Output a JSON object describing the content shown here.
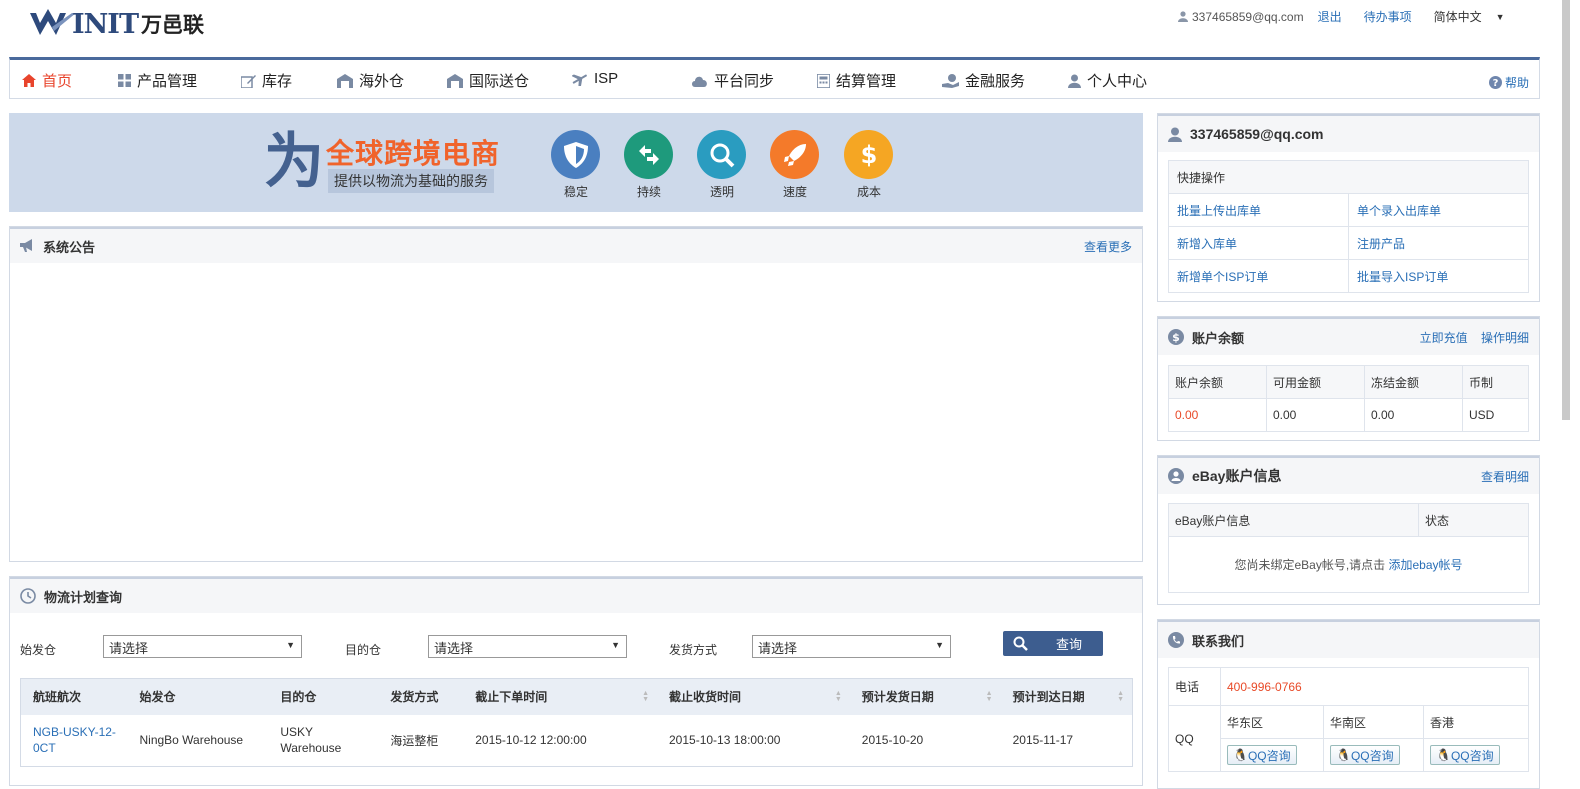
{
  "header": {
    "logo_text": "INIT",
    "logo_cn": "万邑联",
    "user_email": "337465859@qq.com",
    "logout": "退出",
    "todo": "待办事项",
    "language": "简体中文"
  },
  "nav": {
    "items": [
      {
        "label": "首页"
      },
      {
        "label": "产品管理"
      },
      {
        "label": "库存"
      },
      {
        "label": "海外仓"
      },
      {
        "label": "国际送仓"
      },
      {
        "label": "ISP"
      },
      {
        "label": "平台同步"
      },
      {
        "label": "结算管理"
      },
      {
        "label": "金融服务"
      },
      {
        "label": "个人中心"
      }
    ],
    "help": "帮助"
  },
  "banner": {
    "big_char": "为",
    "headline": "全球跨境电商",
    "subline": "提供以物流为基础的服务",
    "features": [
      {
        "label": "稳定",
        "color": "#4a7fc0"
      },
      {
        "label": "持续",
        "color": "#1e9a7c"
      },
      {
        "label": "透明",
        "color": "#2a9cc0"
      },
      {
        "label": "速度",
        "color": "#f47a2a"
      },
      {
        "label": "成本",
        "color": "#f5a623"
      }
    ]
  },
  "announcement": {
    "title": "系统公告",
    "more": "查看更多"
  },
  "plan": {
    "title": "物流计划查询",
    "origin_label": "始发仓",
    "origin_value": "请选择",
    "dest_label": "目的仓",
    "dest_value": "请选择",
    "ship_label": "发货方式",
    "ship_value": "请选择",
    "query_button": "查询",
    "columns": [
      "航班航次",
      "始发仓",
      "目的仓",
      "发货方式",
      "截止下单时间",
      "截止收货时间",
      "预计发货日期",
      "预计到达日期"
    ],
    "rows": [
      {
        "voyage": "NGB-USKY-12-0CT",
        "origin": "NingBo Warehouse",
        "dest": "USKY Warehouse",
        "method": "海运整柜",
        "order_deadline": "2015-10-12 12:00:00",
        "receive_deadline": "2015-10-13 18:00:00",
        "ship_date": "2015-10-20",
        "arrive_date": "2015-11-17"
      }
    ]
  },
  "account": {
    "email": "337465859@qq.com",
    "quick_title": "快捷操作",
    "quick_links": [
      [
        "批量上传出库单",
        "单个录入出库单"
      ],
      [
        "新增入库单",
        "注册产品"
      ],
      [
        "新增单个ISP订单",
        "批量导入ISP订单"
      ]
    ]
  },
  "balance": {
    "title": "账户余额",
    "recharge": "立即充值",
    "detail": "操作明细",
    "headers": [
      "账户余额",
      "可用金额",
      "冻结金额",
      "币制"
    ],
    "values": [
      "0.00",
      "0.00",
      "0.00",
      "USD"
    ]
  },
  "ebay": {
    "title": "eBay账户信息",
    "detail": "查看明细",
    "col_info": "eBay账户信息",
    "col_status": "状态",
    "empty_text": "您尚未绑定eBay帐号,请点击",
    "add_link": "添加ebay帐号"
  },
  "contact": {
    "title": "联系我们",
    "phone_label": "电话",
    "phone": "400-996-0766",
    "qq_label": "QQ",
    "regions": [
      "华东区",
      "华南区",
      "香港"
    ],
    "qq_button": "QQ咨询"
  }
}
